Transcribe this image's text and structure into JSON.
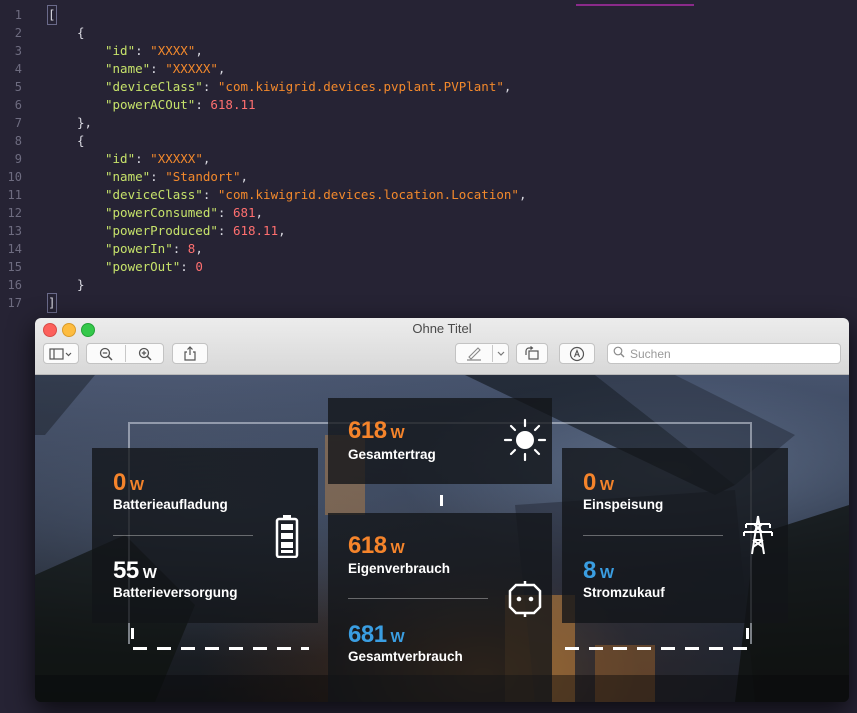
{
  "editor": {
    "lines": [
      {
        "num": "1"
      },
      {
        "num": "2"
      },
      {
        "num": "3"
      },
      {
        "num": "4"
      },
      {
        "num": "5"
      },
      {
        "num": "6"
      },
      {
        "num": "7"
      },
      {
        "num": "8"
      },
      {
        "num": "9"
      },
      {
        "num": "10"
      },
      {
        "num": "11"
      },
      {
        "num": "12"
      },
      {
        "num": "13"
      },
      {
        "num": "14"
      },
      {
        "num": "15"
      },
      {
        "num": "16"
      },
      {
        "num": "17"
      }
    ],
    "open_bracket": "[",
    "close_bracket": "]",
    "open_brace": "{",
    "close_brace_comma": "},",
    "close_brace": "}",
    "obj1": {
      "id_key": "\"id\"",
      "id_val": "\"XXXX\"",
      "name_key": "\"name\"",
      "name_val": "\"XXXXX\"",
      "class_key": "\"deviceClass\"",
      "class_val": "\"com.kiwigrid.devices.pvplant.PVPlant\"",
      "power_key": "\"powerACOut\"",
      "power_val": "618.11"
    },
    "obj2": {
      "id_key": "\"id\"",
      "id_val": "\"XXXXX\"",
      "name_key": "\"name\"",
      "name_val": "\"Standort\"",
      "class_key": "\"deviceClass\"",
      "class_val": "\"com.kiwigrid.devices.location.Location\"",
      "consumed_key": "\"powerConsumed\"",
      "consumed_val": "681",
      "produced_key": "\"powerProduced\"",
      "produced_val": "618.11",
      "in_key": "\"powerIn\"",
      "in_val": "8",
      "out_key": "\"powerOut\"",
      "out_val": "0"
    }
  },
  "window": {
    "title": "Ohne Titel",
    "search_placeholder": "Suchen",
    "icons": [
      "sidebar-toggle-icon",
      "zoom-out-icon",
      "zoom-in-icon",
      "share-icon",
      "markup-pen-icon",
      "rotate-icon",
      "annotate-icon",
      "search-icon"
    ]
  },
  "dashboard": {
    "unit": "W",
    "gesamtertrag": {
      "value": "618",
      "label": "Gesamtertrag"
    },
    "batterieaufladung": {
      "value": "0",
      "label": "Batterieaufladung"
    },
    "batterieversorgung": {
      "value": "55",
      "label": "Batterieversorgung"
    },
    "eigenverbrauch": {
      "value": "618",
      "label": "Eigenverbrauch"
    },
    "gesamtverbrauch": {
      "value": "681",
      "label": "Gesamtverbrauch"
    },
    "einspeisung": {
      "value": "0",
      "label": "Einspeisung"
    },
    "stromzukauf": {
      "value": "8",
      "label": "Stromzukauf"
    },
    "colors": {
      "produce": "#f5842b",
      "consume": "#3a9ee2",
      "neutral": "#ffffff"
    },
    "icons": [
      "sun-icon",
      "battery-icon",
      "power-pylon-icon",
      "socket-icon"
    ]
  }
}
